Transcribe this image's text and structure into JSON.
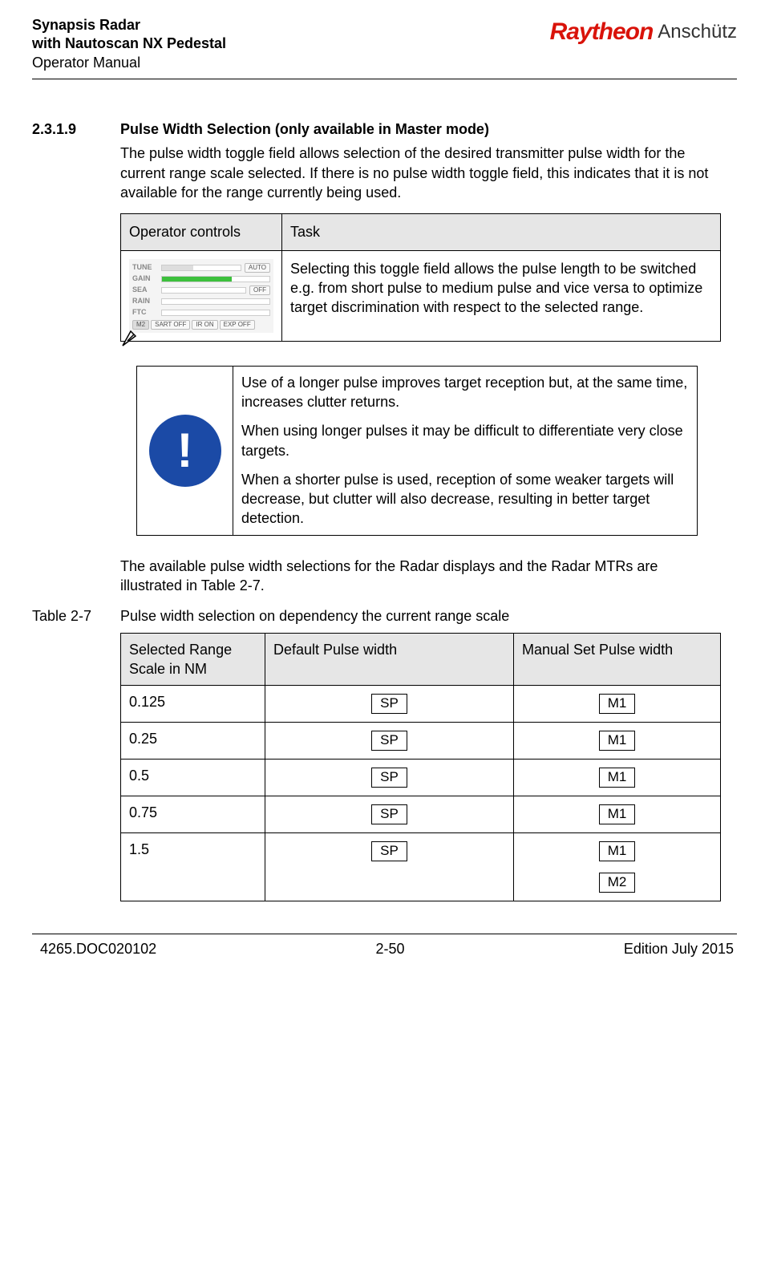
{
  "header": {
    "title_line1": "Synapsis Radar",
    "title_line2": "with Nautoscan NX Pedestal",
    "title_line3": "Operator Manual",
    "brand_main": "Raytheon",
    "brand_sub": "Anschütz"
  },
  "section": {
    "number": "2.3.1.9",
    "title": "Pulse Width Selection (only available in Master mode)",
    "intro": "The pulse width toggle field allows selection of the desired transmitter pulse width for the current range scale selected. If there is no pulse width toggle field, this indicates that it is not available for the range currently being used."
  },
  "op_table": {
    "head_col1": "Operator controls",
    "head_col2": "Task",
    "task_text": "Selecting this toggle field allows the pulse length to be switched e.g. from short pulse to medium pulse and vice versa to optimize target discrimination with respect to the selected range.",
    "panel": {
      "rows": [
        "TUNE",
        "GAIN",
        "SEA",
        "RAIN",
        "FTC"
      ],
      "btn_auto": "AUTO",
      "btn_off": "OFF",
      "bottom": [
        "M2",
        "SART OFF",
        "IR ON",
        "EXP OFF"
      ]
    }
  },
  "note": {
    "p1": "Use of a longer pulse improves target reception but, at the same time, increases clutter returns.",
    "p2": "When using longer pulses it may be difficult to differentiate very close targets.",
    "p3": "When a shorter pulse is used, reception of some weaker targets will decrease, but clutter will also decrease, resulting in better target detection."
  },
  "mid_para": "The available pulse width selections for the Radar displays and the Radar MTRs are illustrated in Table 2-7.",
  "table27": {
    "label": "Table 2-7",
    "caption": "Pulse width selection on dependency the current range scale",
    "head": {
      "c1": "Selected Range Scale in NM",
      "c2": "Default Pulse width",
      "c3": "Manual Set Pulse width"
    },
    "rows": [
      {
        "range": "0.125",
        "default": [
          "SP"
        ],
        "manual": [
          "M1"
        ]
      },
      {
        "range": "0.25",
        "default": [
          "SP"
        ],
        "manual": [
          "M1"
        ]
      },
      {
        "range": "0.5",
        "default": [
          "SP"
        ],
        "manual": [
          "M1"
        ]
      },
      {
        "range": "0.75",
        "default": [
          "SP"
        ],
        "manual": [
          "M1"
        ]
      },
      {
        "range": "1.5",
        "default": [
          "SP"
        ],
        "manual": [
          "M1",
          "M2"
        ]
      }
    ]
  },
  "footer": {
    "left": "4265.DOC020102",
    "center": "2-50",
    "right": "Edition July 2015"
  },
  "chart_data": {
    "type": "table",
    "title": "Pulse width selection on dependency the current range scale",
    "columns": [
      "Selected Range Scale in NM",
      "Default Pulse width",
      "Manual Set Pulse width"
    ],
    "rows": [
      [
        "0.125",
        "SP",
        "M1"
      ],
      [
        "0.25",
        "SP",
        "M1"
      ],
      [
        "0.5",
        "SP",
        "M1"
      ],
      [
        "0.75",
        "SP",
        "M1"
      ],
      [
        "1.5",
        "SP",
        "M1, M2"
      ]
    ]
  }
}
